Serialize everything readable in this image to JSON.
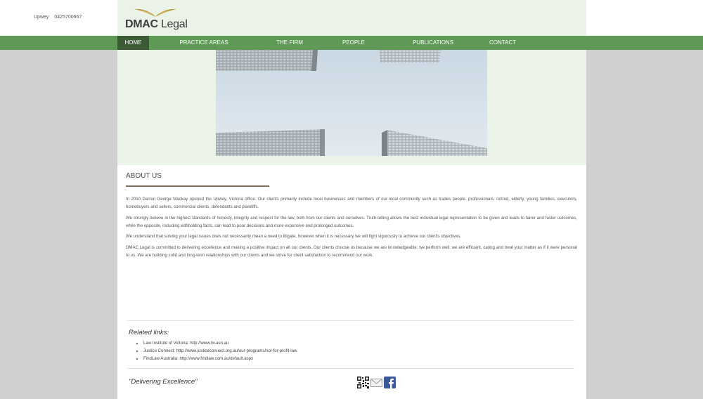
{
  "topbar": {
    "location": "Upwey",
    "phone": "0425700667"
  },
  "logo": {
    "text": "DMAC Legal",
    "part1": "DMAC",
    "part2": " Legal"
  },
  "nav": {
    "items": [
      {
        "label": "HOME"
      },
      {
        "label": "PRACTICE AREAS"
      },
      {
        "label": "THE FIRM"
      },
      {
        "label": "PEOPLE"
      },
      {
        "label": "PUBLICATIONS"
      },
      {
        "label": "CONTACT"
      }
    ]
  },
  "about": {
    "title": "ABOUT US",
    "paragraphs": [
      "In 2010 Darren George Mackay opened the Upwey, Victoria office. Our clients primarily include local businesses and members of our local community such as trades people, professionals, retired, elderly, young families, executors, homebuyers and sellers, commercial clients, defendants and plaintiffs.",
      "We strongly believe in the highest standards of honesty, integrity and respect for the law, both from our clients and ourselves. Truth-telling allows the best individual legal representation to be given and leads to fairer and faster outcomes, while the opposite, including withholding facts, can lead to poor decisions and more expensive and prolonged outcomes.",
      "We understand that solving your legal issues does not necessarily mean a need to litigate, however when it is necessary we will fight vigorously to achieve our client's objectives.",
      "DMAC Legal is committed to delivering excellence and making a positive impact on all our clients. Our clients choose us because we are knowledgeable; we perform well; we are efficient, caring and treat your matter as if it were personal to us. We are building solid and long-term relationships with our clients and we strive for client satisfaction to recommend our work."
    ]
  },
  "related": {
    "title": "Related links:",
    "links": [
      "Law Institute of Victoria: http://www.liv.asn.au",
      "Justice Connect: http://www.justiceconnect.org.au/our-programs/not-for-profit-law",
      "FindLaw Australia: http://www.findlaw.com.au/default.aspx"
    ]
  },
  "footer": {
    "tagline": "\"Delivering Excellence\"",
    "icons": [
      "qr-code-icon",
      "email-icon",
      "facebook-icon"
    ]
  },
  "colors": {
    "nav_green": "#5e9a56",
    "nav_active": "#3c5a36",
    "pale_green": "#ebf2e8",
    "logo_gold": "#b89a3a"
  }
}
